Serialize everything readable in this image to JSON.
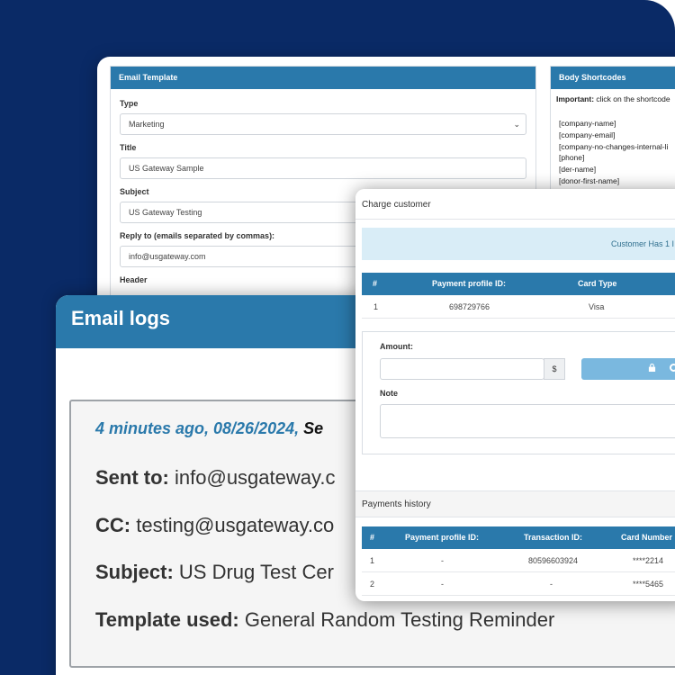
{
  "email_template": {
    "header": "Email Template",
    "type_label": "Type",
    "type_value": "Marketing",
    "title_label": "Title",
    "title_value": "US Gateway Sample",
    "subject_label": "Subject",
    "subject_value": "US Gateway Testing",
    "reply_label": "Reply to (emails separated by commas):",
    "reply_value": "info@usgateway.com",
    "header_label": "Header"
  },
  "body_shortcodes": {
    "header": "Body Shortcodes",
    "important_label": "Important:",
    "important_text": "click on the shortcode",
    "codes": [
      "[company-name]",
      "[company-email]",
      "[company-no-changes-internal-li",
      "[phone]",
      "[der-name]",
      "[donor-first-name]"
    ]
  },
  "email_logs": {
    "header": "Email logs",
    "time_text": "4 minutes ago, 08/26/2024,",
    "time_rest": "Se",
    "sent_label": "Sent to:",
    "sent_value": "info@usgateway.c",
    "cc_label": "CC:",
    "cc_value": "testing@usgateway.co",
    "subject_label": "Subject:",
    "subject_value": "US Drug Test Cer",
    "template_label": "Template used:",
    "template_value": "General Random Testing Reminder"
  },
  "charge_customer": {
    "header": "Charge customer",
    "alert": "Customer Has 1 I",
    "profiles_table": {
      "headers": [
        "#",
        "Payment profile ID:",
        "Card Type"
      ],
      "rows": [
        [
          "1",
          "698729766",
          "Visa"
        ]
      ]
    },
    "amount_label": "Amount:",
    "currency": "$",
    "note_label": "Note",
    "history_header": "Payments history",
    "history_table": {
      "headers": [
        "#",
        "Payment profile ID:",
        "Transaction ID:",
        "Card Number"
      ],
      "rows": [
        [
          "1",
          "-",
          "80596603924",
          "****2214"
        ],
        [
          "2",
          "-",
          "-",
          "****5465"
        ]
      ]
    }
  },
  "colors": {
    "background_navy": "#0a2a66",
    "header_blue": "#2a79ab",
    "button_light_blue": "#7ab8df",
    "alert_bg": "#d9edf7"
  }
}
